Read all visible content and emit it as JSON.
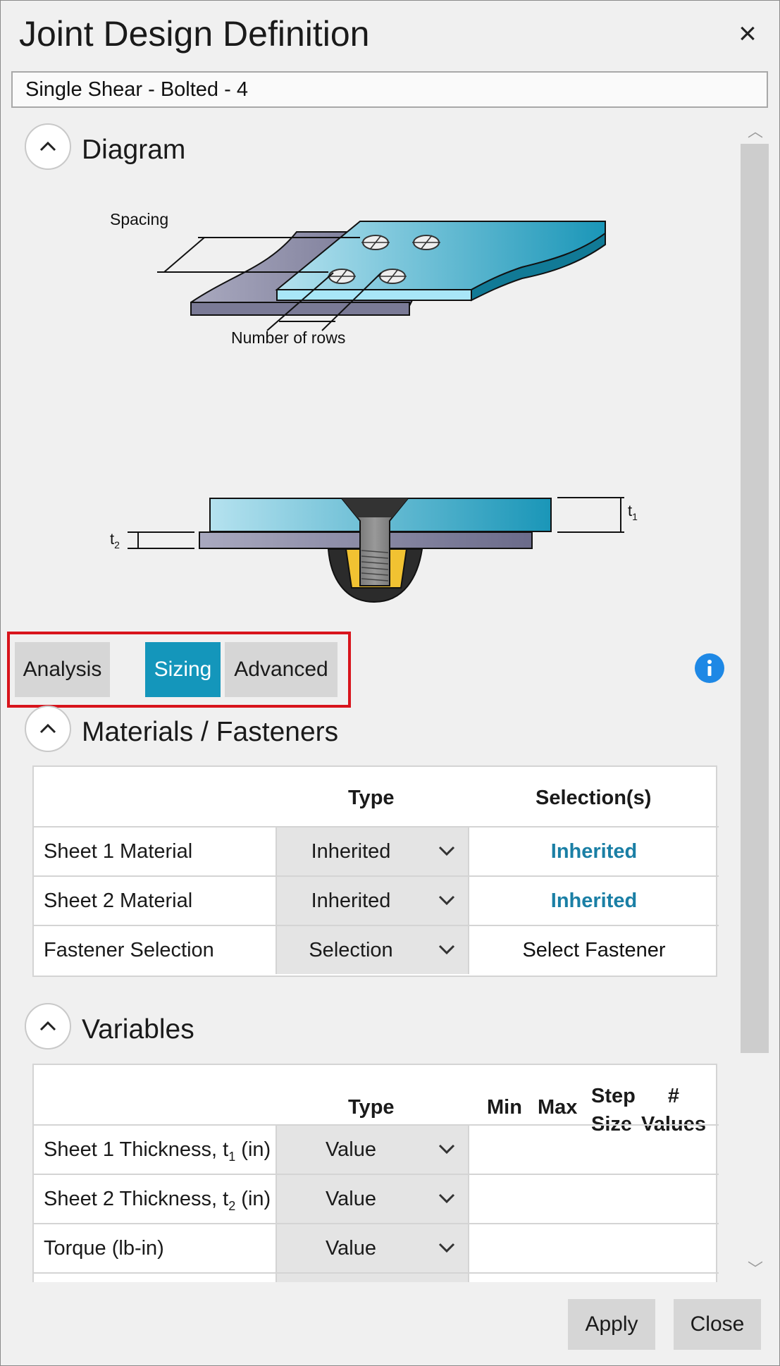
{
  "window": {
    "title": "Joint Design Definition",
    "close_label": "×",
    "design_name": "Single Shear - Bolted - 4"
  },
  "diagram": {
    "heading": "Diagram",
    "label_spacing": "Spacing",
    "label_rows": "Number of rows",
    "label_t1": "t",
    "label_t1_sub": "1",
    "label_t2": "t",
    "label_t2_sub": "2"
  },
  "tabs": {
    "items": [
      {
        "label": "Analysis",
        "active": false
      },
      {
        "label": "Sizing",
        "active": true
      },
      {
        "label": "Advanced",
        "active": false
      }
    ],
    "info_icon": "i"
  },
  "materials": {
    "heading": "Materials / Fasteners",
    "col_type": "Type",
    "col_selection": "Selection(s)",
    "rows": [
      {
        "label": "Sheet 1 Material",
        "type": "Inherited",
        "selection": "Inherited"
      },
      {
        "label": "Sheet 2 Material",
        "type": "Inherited",
        "selection": "Inherited"
      },
      {
        "label": "Fastener Selection",
        "type": "Selection",
        "selection": "Select Fastener"
      }
    ]
  },
  "variables": {
    "heading": "Variables",
    "col_type": "Type",
    "col_min": "Min",
    "col_max": "Max",
    "col_step_1": "Step",
    "col_step_2": "Size",
    "col_values_1": "#",
    "col_values_2": "Values",
    "rows": [
      {
        "label": "Sheet 1 Thickness, t",
        "sub": "1",
        "unit": " (in)",
        "type": "Value"
      },
      {
        "label": "Sheet 2 Thickness, t",
        "sub": "2",
        "unit": " (in)",
        "type": "Value"
      },
      {
        "label": "Torque (lb-in)",
        "sub": "",
        "unit": "",
        "type": "Value"
      }
    ]
  },
  "footer": {
    "apply_label": "Apply",
    "close_label": "Close"
  },
  "colors": {
    "accent": "#1496bb",
    "link": "#1a7fa5",
    "highlight_border": "#d8141c",
    "info": "#1e88e5"
  }
}
